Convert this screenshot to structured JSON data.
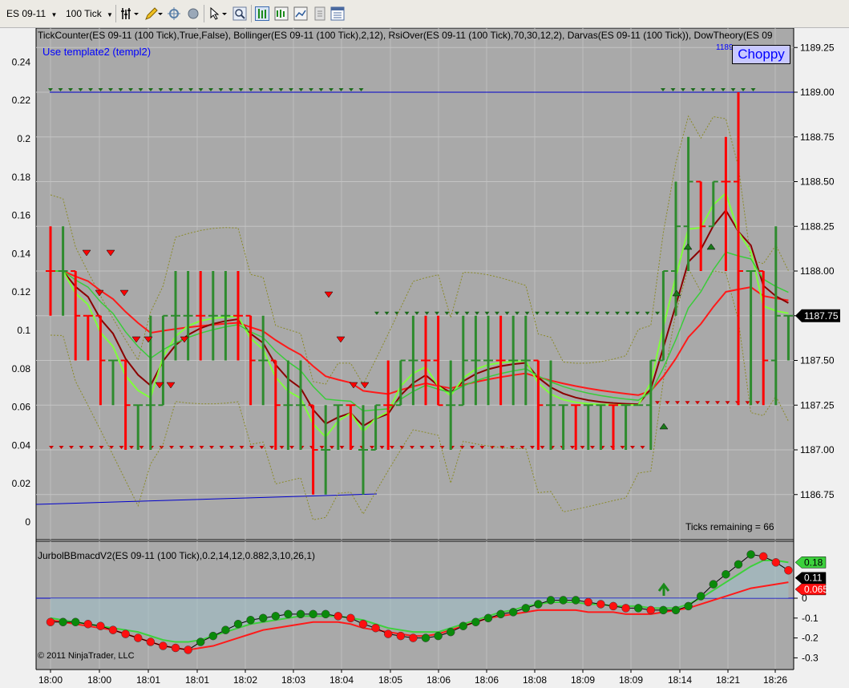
{
  "toolbar": {
    "instrument": "ES 09-11",
    "interval": "100 Tick",
    "icons": [
      "bar-style-icon",
      "pencil-icon",
      "crosshair-icon",
      "magnet-icon",
      "cursor-icon",
      "zoom-icon",
      "chart-style-icon",
      "indicators-icon",
      "strategy-icon",
      "data-box-icon",
      "properties-icon"
    ]
  },
  "price_panel": {
    "indicator_title": "TickCounter(ES 09-11 (100 Tick),True,False), Bollinger(ES 09-11 (100 Tick),2,12), RsiOver(ES 09-11 (100 Tick),70,30,12,2), Darvas(ES 09-11 (100 Tick)), DowTheory(ES 09",
    "template_label": "Use template2 (templ2)",
    "badge": "Choppy",
    "badge_sub": "1189",
    "ticks_remaining": "Ticks remaining = 66",
    "right_axis": [
      "1189.25",
      "1189.00",
      "1188.75",
      "1188.50",
      "1188.25",
      "1188.00",
      "1187.75",
      "1187.50",
      "1187.25",
      "1187.00",
      "1186.75"
    ],
    "left_axis": [
      "0.24",
      "0.22",
      "0.2",
      "0.18",
      "0.16",
      "0.14",
      "0.12",
      "0.1",
      "0.08",
      "0.06",
      "0.04",
      "0.02",
      "0"
    ],
    "last_price": "1187.75"
  },
  "macd_panel": {
    "title": "JurbolBBmacdV2(ES 09-11 (100 Tick),0.2,14,12,0.882,3,10,26,1)",
    "right_axis": [
      "0",
      "-0.1",
      "-0.2",
      "-0.3"
    ],
    "value_green": "0.18",
    "value_black": "0.11",
    "value_red": "0.065"
  },
  "copyright": "© 2011 NinjaTrader, LLC",
  "time_axis": [
    "18:00",
    "18:00",
    "18:01",
    "18:01",
    "18:02",
    "18:03",
    "18:04",
    "18:05",
    "18:06",
    "18:06",
    "18:08",
    "18:09",
    "18:09",
    "18:14",
    "18:21",
    "18:26"
  ],
  "colors": {
    "background": "#a9a9a9",
    "bull": "#2e8b2e",
    "bear": "#ff0000",
    "blue_line": "#0000cc",
    "badge_bg": "#c8c8ff"
  },
  "chart_data": {
    "type": "line",
    "price_bars": {
      "x": [
        1,
        2,
        3,
        4,
        5,
        6,
        7,
        8,
        9,
        10,
        11,
        12,
        13,
        14,
        15,
        16,
        17,
        18,
        19,
        20,
        21,
        22,
        23,
        24,
        25,
        26,
        27,
        28,
        29,
        30,
        31,
        32,
        33,
        34,
        35,
        36,
        37,
        38,
        39,
        40,
        41,
        42,
        43,
        44,
        45,
        46,
        47,
        48,
        49,
        50,
        51,
        52,
        53,
        54,
        55,
        56,
        57,
        58,
        59,
        60
      ],
      "open": [
        1188.0,
        1188.0,
        1188.0,
        1187.75,
        1187.75,
        1187.5,
        1187.5,
        1187.25,
        1187.25,
        1187.25,
        1187.75,
        1187.75,
        1187.75,
        1187.75,
        1187.75,
        1187.75,
        1187.75,
        1187.5,
        1187.5,
        1187.25,
        1187.25,
        1187.25,
        1187.0,
        1187.25,
        1187.25,
        1187.0,
        1187.0,
        1187.25,
        1187.25,
        1187.5,
        1187.5,
        1187.5,
        1187.25,
        1187.25,
        1187.5,
        1187.5,
        1187.5,
        1187.5,
        1187.5,
        1187.5,
        1187.25,
        1187.25,
        1187.25,
        1187.25,
        1187.25,
        1187.25,
        1187.25,
        1187.25,
        1187.25,
        1187.5,
        1188.0,
        1188.25,
        1188.5,
        1188.25,
        1188.5,
        1188.5,
        1188.0,
        1188.0,
        1187.5,
        1187.75
      ],
      "close": [
        1188.0,
        1188.0,
        1187.75,
        1187.75,
        1187.5,
        1187.5,
        1187.25,
        1187.25,
        1187.25,
        1187.75,
        1187.75,
        1187.75,
        1187.75,
        1187.75,
        1187.75,
        1187.75,
        1187.5,
        1187.5,
        1187.25,
        1187.25,
        1187.25,
        1187.0,
        1187.0,
        1187.25,
        1187.25,
        1187.0,
        1187.25,
        1187.25,
        1187.5,
        1187.5,
        1187.5,
        1187.25,
        1187.25,
        1187.5,
        1187.5,
        1187.5,
        1187.5,
        1187.5,
        1187.5,
        1187.25,
        1187.25,
        1187.25,
        1187.25,
        1187.25,
        1187.25,
        1187.25,
        1187.25,
        1187.25,
        1187.5,
        1188.0,
        1188.25,
        1188.5,
        1188.25,
        1188.5,
        1188.5,
        1188.0,
        1188.0,
        1187.5,
        1187.75,
        1187.75
      ],
      "high": [
        1188.25,
        1188.25,
        1188.0,
        1187.75,
        1187.75,
        1187.5,
        1187.5,
        1187.25,
        1187.75,
        1187.75,
        1188.0,
        1188.0,
        1188.0,
        1188.0,
        1188.0,
        1188.0,
        1187.75,
        1187.75,
        1187.5,
        1187.5,
        1187.5,
        1187.25,
        1187.25,
        1187.25,
        1187.25,
        1187.25,
        1187.25,
        1187.5,
        1187.5,
        1187.75,
        1187.75,
        1187.75,
        1187.5,
        1187.75,
        1187.75,
        1187.75,
        1187.75,
        1187.75,
        1187.75,
        1187.5,
        1187.5,
        1187.25,
        1187.25,
        1187.25,
        1187.25,
        1187.25,
        1187.25,
        1187.25,
        1187.5,
        1188.0,
        1188.5,
        1188.75,
        1188.5,
        1188.5,
        1188.75,
        1189.0,
        1188.0,
        1188.0,
        1188.25,
        1187.75
      ],
      "low": [
        1187.75,
        1187.75,
        1187.5,
        1187.5,
        1187.25,
        1187.25,
        1187.0,
        1187.0,
        1187.0,
        1187.25,
        1187.5,
        1187.5,
        1187.5,
        1187.5,
        1187.5,
        1187.5,
        1187.25,
        1187.25,
        1187.0,
        1187.0,
        1187.0,
        1186.75,
        1186.75,
        1187.0,
        1187.0,
        1186.75,
        1187.0,
        1187.0,
        1187.25,
        1187.25,
        1187.25,
        1187.25,
        1187.0,
        1187.25,
        1187.25,
        1187.25,
        1187.25,
        1187.25,
        1187.25,
        1187.0,
        1187.0,
        1187.0,
        1187.0,
        1187.0,
        1187.0,
        1187.0,
        1187.0,
        1187.25,
        1187.0,
        1187.5,
        1187.75,
        1188.0,
        1188.0,
        1188.25,
        1188.0,
        1187.25,
        1187.25,
        1187.25,
        1187.25,
        1187.5
      ]
    },
    "price_markers": {
      "resistance_top": 1189.0,
      "support_left": 1187.0,
      "resistance_mid": 1187.75,
      "support_right": 1187.25,
      "channel_top_right": 1189.0
    },
    "macd": {
      "x": [
        1,
        2,
        3,
        4,
        5,
        6,
        7,
        8,
        9,
        10,
        11,
        12,
        13,
        14,
        15,
        16,
        17,
        18,
        19,
        20,
        21,
        22,
        23,
        24,
        25,
        26,
        27,
        28,
        29,
        30,
        31,
        32,
        33,
        34,
        35,
        36,
        37,
        38,
        39,
        40,
        41,
        42,
        43,
        44,
        45,
        46,
        47,
        48,
        49,
        50,
        51,
        52,
        53,
        54,
        55,
        56,
        57,
        58,
        59,
        60
      ],
      "dots": [
        -0.12,
        -0.12,
        -0.12,
        -0.13,
        -0.14,
        -0.16,
        -0.18,
        -0.2,
        -0.22,
        -0.24,
        -0.25,
        -0.26,
        -0.22,
        -0.19,
        -0.16,
        -0.13,
        -0.11,
        -0.1,
        -0.09,
        -0.08,
        -0.08,
        -0.08,
        -0.08,
        -0.09,
        -0.1,
        -0.13,
        -0.15,
        -0.18,
        -0.19,
        -0.2,
        -0.2,
        -0.19,
        -0.17,
        -0.14,
        -0.12,
        -0.1,
        -0.08,
        -0.07,
        -0.05,
        -0.03,
        -0.01,
        -0.01,
        -0.01,
        -0.02,
        -0.03,
        -0.04,
        -0.05,
        -0.05,
        -0.06,
        -0.06,
        -0.06,
        -0.04,
        0.01,
        0.07,
        0.12,
        0.17,
        0.22,
        0.21,
        0.18,
        0.14
      ],
      "signal": [
        -0.1,
        -0.11,
        -0.12,
        -0.13,
        -0.14,
        -0.15,
        -0.16,
        -0.17,
        -0.19,
        -0.21,
        -0.22,
        -0.22,
        -0.21,
        -0.19,
        -0.17,
        -0.15,
        -0.13,
        -0.12,
        -0.11,
        -0.1,
        -0.09,
        -0.09,
        -0.09,
        -0.09,
        -0.1,
        -0.11,
        -0.13,
        -0.15,
        -0.16,
        -0.17,
        -0.17,
        -0.17,
        -0.15,
        -0.13,
        -0.11,
        -0.09,
        -0.07,
        -0.06,
        -0.04,
        -0.03,
        -0.02,
        -0.02,
        -0.02,
        -0.03,
        -0.03,
        -0.04,
        -0.04,
        -0.04,
        -0.05,
        -0.05,
        -0.05,
        -0.03,
        0.0,
        0.04,
        0.08,
        0.12,
        0.16,
        0.19,
        0.19,
        0.18
      ],
      "trigger": [
        -0.11,
        -0.12,
        -0.13,
        -0.14,
        -0.15,
        -0.16,
        -0.18,
        -0.2,
        -0.22,
        -0.24,
        -0.25,
        -0.26,
        -0.25,
        -0.24,
        -0.22,
        -0.2,
        -0.18,
        -0.16,
        -0.15,
        -0.14,
        -0.13,
        -0.12,
        -0.12,
        -0.12,
        -0.13,
        -0.15,
        -0.16,
        -0.17,
        -0.18,
        -0.19,
        -0.19,
        -0.18,
        -0.16,
        -0.14,
        -0.12,
        -0.1,
        -0.09,
        -0.08,
        -0.07,
        -0.06,
        -0.06,
        -0.06,
        -0.06,
        -0.07,
        -0.07,
        -0.07,
        -0.08,
        -0.08,
        -0.08,
        -0.07,
        -0.06,
        -0.05,
        -0.03,
        -0.01,
        0.01,
        0.03,
        0.05,
        0.06,
        0.07,
        0.08
      ],
      "ylim": [
        -0.3,
        0.25
      ]
    }
  }
}
